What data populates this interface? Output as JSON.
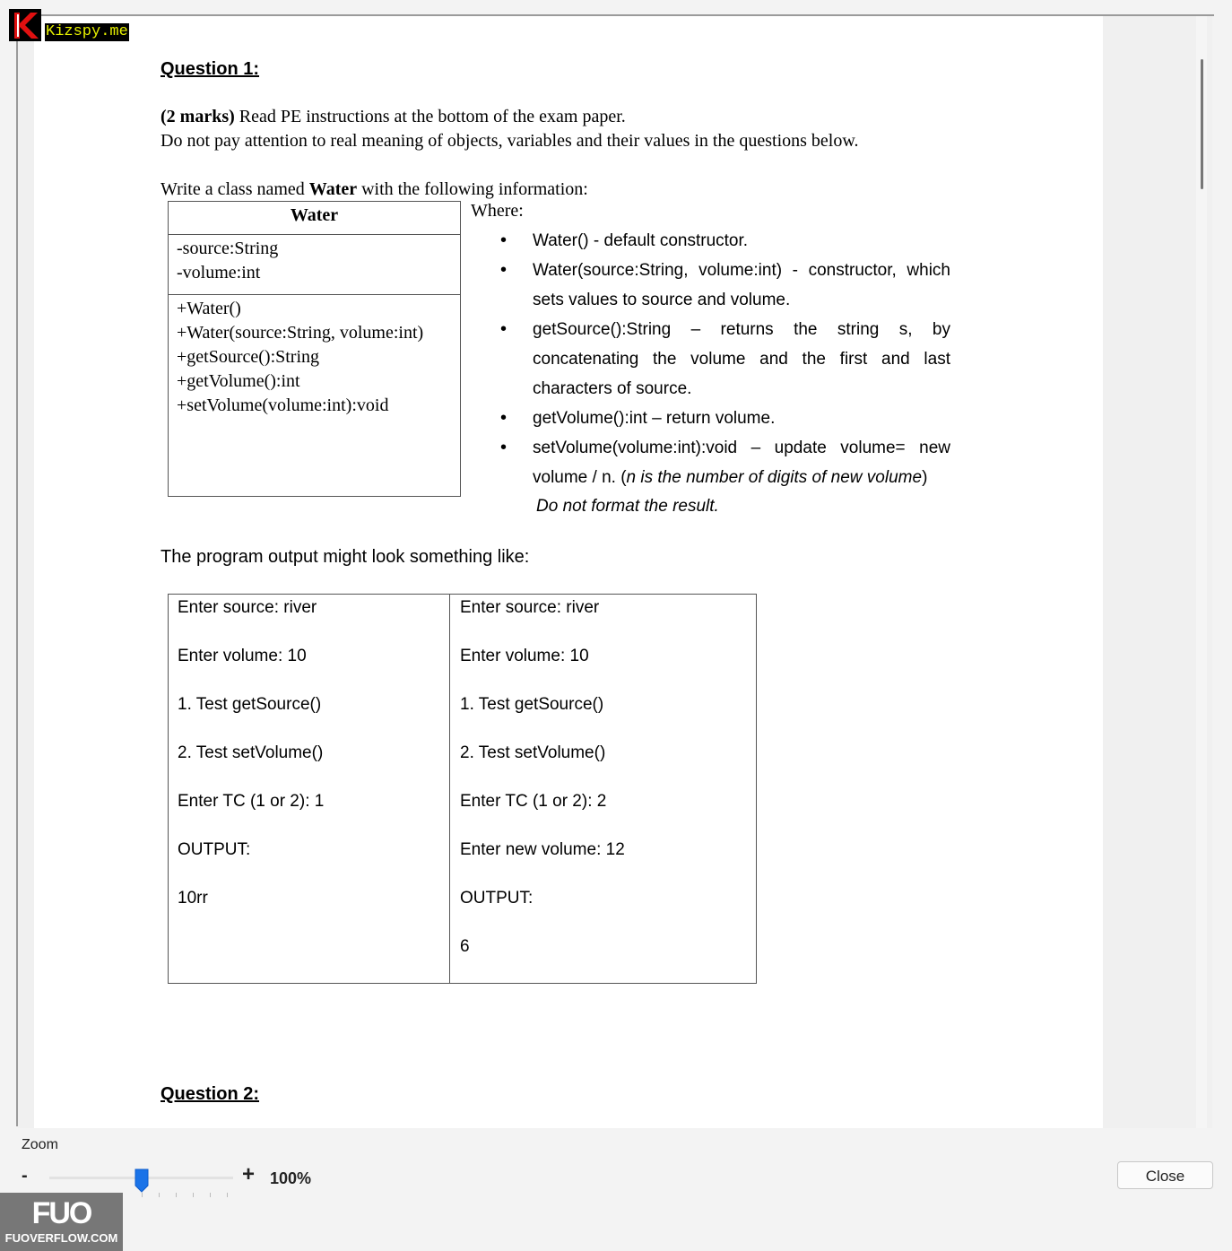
{
  "watermarks": {
    "top_left_badge": "Kizspy.me",
    "bottom_left_logo_mark": "FUO",
    "bottom_left_logo_text": "FUOVERFLOW.COM"
  },
  "document": {
    "q1_title": "Question 1:",
    "marks": "(2 marks)",
    "intro_line1_rest": " Read PE instructions at the bottom of the exam paper.",
    "intro_line2": "Do not pay attention to real  meaning of objects, variables and their values in the questions below.",
    "write_prefix": "Write  a class named ",
    "write_class": "Water",
    "write_suffix": " with the following information:",
    "uml": {
      "class_name": "Water",
      "attributes": [
        "-source:String",
        "-volume:int"
      ],
      "methods": [
        "+Water()",
        "+Water(source:String, volume:int)",
        "+getSource():String",
        "+getVolume():int",
        "+setVolume(volume:int):void"
      ]
    },
    "where_label": "Where:",
    "bullets": [
      "Water() - default constructor.",
      "Water(source:String, volume:int) - constructor, which sets values to source and volume.",
      "getSource():String  –  returns  the  string  s,  by concatenating the volume and the first and last characters of source.",
      "getVolume():int – return volume."
    ],
    "bullet5_text": "setVolume(volume:int):void  –  update  volume=  new volume / n. (",
    "bullet5_italic": "n is the number of digits of new volume",
    "bullet5_end": ")",
    "note": "Do not format the result.",
    "output_intro": "The program output might look something like:",
    "output_left": [
      "Enter source: river",
      "Enter volume: 10",
      "1. Test getSource()",
      "2. Test setVolume()",
      "Enter TC (1 or 2): 1",
      "OUTPUT:",
      "10rr"
    ],
    "output_right": [
      "Enter source: river",
      "Enter volume: 10",
      "1. Test getSource()",
      "2. Test setVolume()",
      "Enter TC (1 or 2): 2",
      "Enter new volume: 12",
      "OUTPUT:",
      "6"
    ],
    "q2_title": "Question 2:"
  },
  "controls": {
    "zoom_label": "Zoom",
    "zoom_minus": "-",
    "zoom_plus": "+",
    "zoom_value": "100%",
    "zoom_fraction": 0.5,
    "close_label": "Close"
  },
  "colors": {
    "slider_thumb": "#1a73e8",
    "badge_text": "#e6f000",
    "logo_bg": "#777777"
  }
}
